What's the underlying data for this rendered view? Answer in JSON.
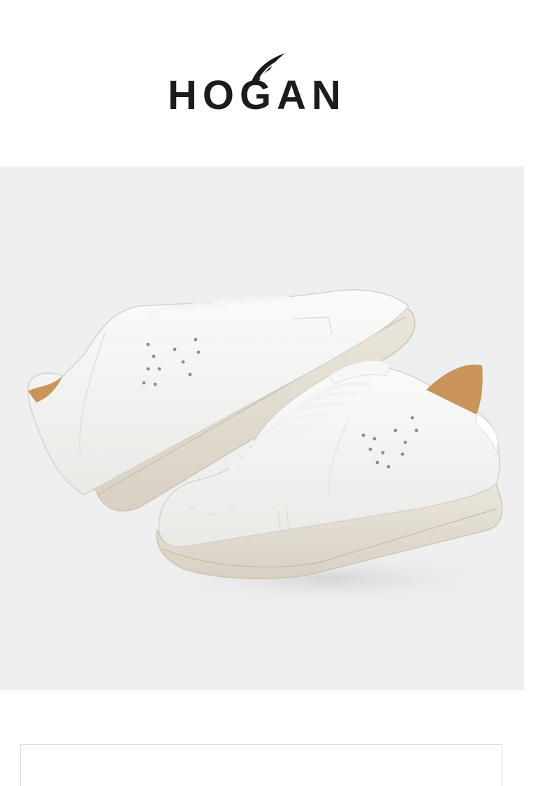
{
  "brand": {
    "logo_text": "HOGAN",
    "logo_icon": "winged-logo-icon",
    "text_color": "#1c1c1c"
  },
  "hero": {
    "image_subject": "product-photo",
    "background_color": "#efefef"
  },
  "colors": {
    "page_background": "#ffffff",
    "card_border": "#dcdcdc",
    "leather": "#f7f7f5",
    "sole": "#e6e1d6",
    "lining": "#c9955b"
  }
}
